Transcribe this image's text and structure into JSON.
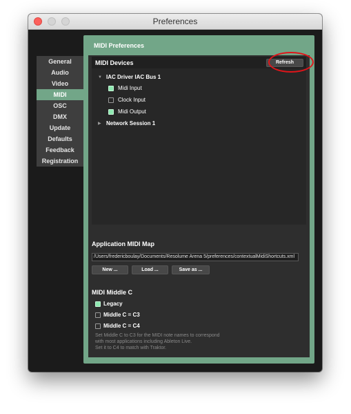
{
  "window": {
    "title": "Preferences"
  },
  "sidebar": {
    "items": [
      {
        "label": "General"
      },
      {
        "label": "Audio"
      },
      {
        "label": "Video"
      },
      {
        "label": "MIDI"
      },
      {
        "label": "OSC"
      },
      {
        "label": "DMX"
      },
      {
        "label": "Update"
      },
      {
        "label": "Defaults"
      },
      {
        "label": "Feedback"
      },
      {
        "label": "Registration"
      }
    ],
    "active": "MIDI"
  },
  "panel": {
    "title": "MIDI Preferences"
  },
  "midi_devices": {
    "label": "MIDI Devices",
    "refresh_label": "Refresh",
    "devices": [
      {
        "name": "IAC Driver IAC Bus 1",
        "expanded": true,
        "options": [
          {
            "label": "Midi Input",
            "checked": true
          },
          {
            "label": "Clock Input",
            "checked": false
          },
          {
            "label": "Midi Output",
            "checked": true
          }
        ]
      },
      {
        "name": "Network Session 1",
        "expanded": false
      }
    ]
  },
  "app_midi_map": {
    "label": "Application MIDI Map",
    "path": "/Users/fredericboulay/Documents/Resolume Arena 5/preferences/contextualMidiShortcuts.xml",
    "buttons": {
      "new": "New ...",
      "load": "Load ...",
      "save_as": "Save as ..."
    }
  },
  "midi_middle_c": {
    "label": "MIDI Middle C",
    "options": [
      {
        "label": "Legacy",
        "checked": true
      },
      {
        "label": "Middle C = C3",
        "checked": false
      },
      {
        "label": "Middle C = C4",
        "checked": false
      }
    ],
    "help_lines": [
      "Set Middle C to C3 for the MIDI note names to correspond",
      "with most applications including Ableton Live.",
      "Set it to C4 to match with Traktor."
    ]
  },
  "colors": {
    "accent": "#72a688",
    "checkbox_on": "#8de8b0",
    "annotation": "#e0151a"
  }
}
